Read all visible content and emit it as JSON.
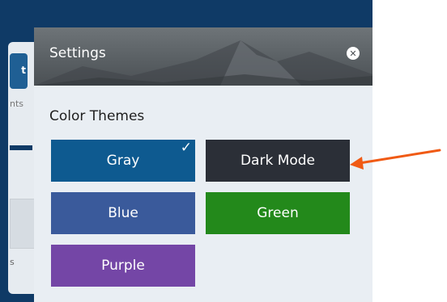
{
  "background_app": {
    "left_fragment_1": "nts",
    "left_fragment_2": "s",
    "tile_glyph": "t"
  },
  "settings": {
    "title": "Settings",
    "close_icon": "close-icon",
    "section_title": "Color Themes",
    "themes": [
      {
        "label": "Gray",
        "color": "#0e5a90",
        "selected": true
      },
      {
        "label": "Dark Mode",
        "color": "#2b2f37",
        "selected": false
      },
      {
        "label": "Blue",
        "color": "#3a5a9b",
        "selected": false
      },
      {
        "label": "Green",
        "color": "#23891b",
        "selected": false
      },
      {
        "label": "Purple",
        "color": "#7446a6",
        "selected": false
      }
    ],
    "check_mark": "✓"
  },
  "annotation": {
    "arrow_color": "#f05a14",
    "points_to": "Dark Mode"
  }
}
